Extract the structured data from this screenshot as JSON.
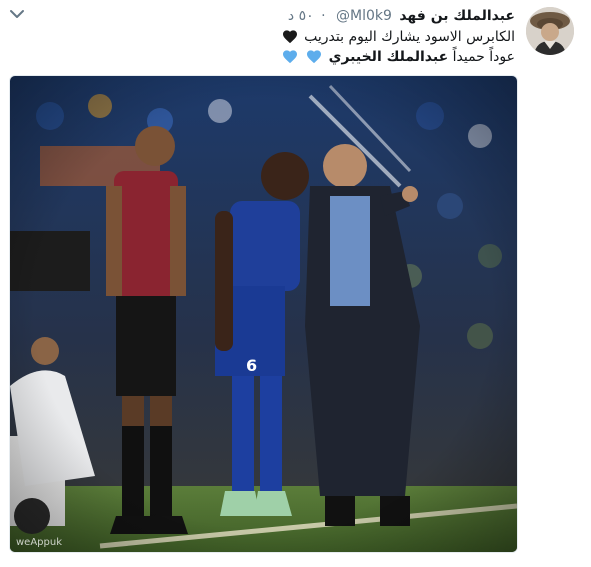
{
  "tweet": {
    "author_name": "عبدالملك بن فهد",
    "handle": "@Ml0k9",
    "separator": "·",
    "time": "٥٠ د",
    "text_line1": "الكابرس الاسود يشارك اليوم بتدريب",
    "text_line2_prefix": "عوداً حميداً",
    "mention": "عبدالملك الخيبري",
    "icons": {
      "caret": "chevron-down-icon",
      "black_heart": "black-heart-icon",
      "blue_heart": "blue-heart-icon"
    },
    "colors": {
      "black_heart": "#1a1a1a",
      "blue_heart": "#5dadec",
      "link_blue": "#1b95e0",
      "meta_grey": "#657786"
    },
    "photo_watermark": "weAppuk"
  }
}
